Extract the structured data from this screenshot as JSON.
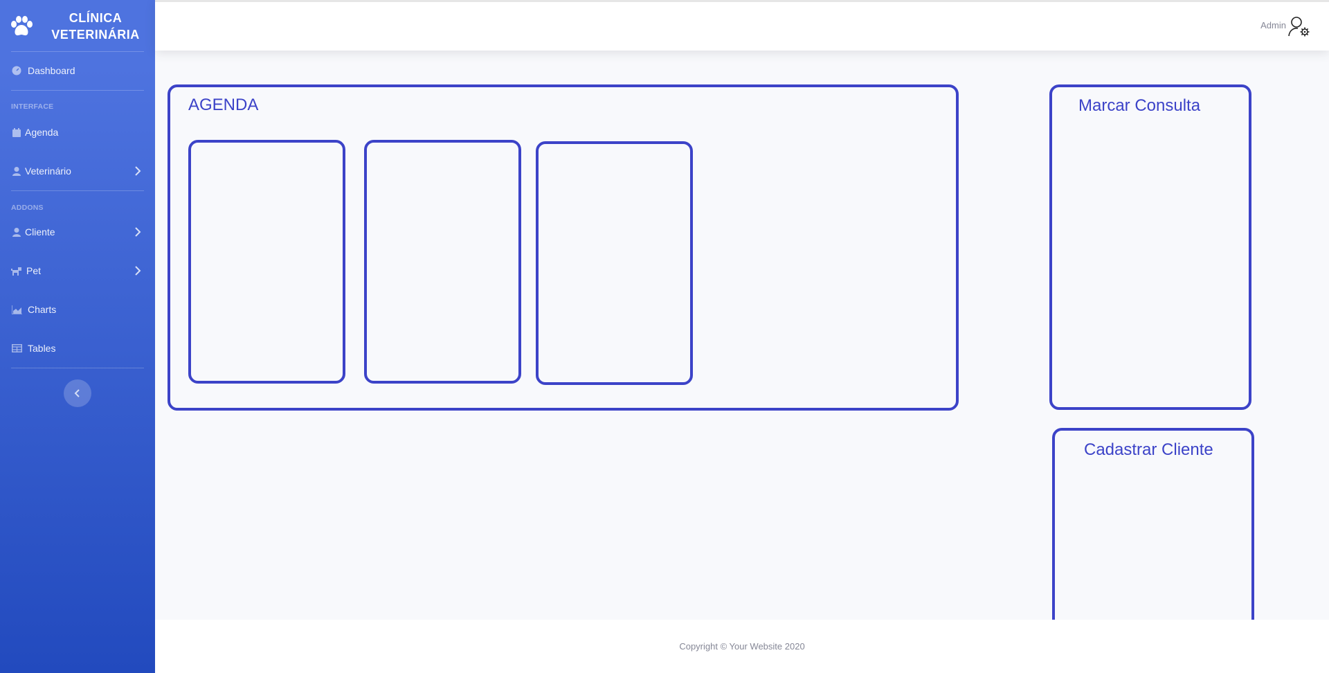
{
  "brand": {
    "line1": "CLÍNICA",
    "line2": "VETERINÁRIA",
    "icon": "paw-icon"
  },
  "sidebar": {
    "dashboard": {
      "label": "Dashboard",
      "icon": "tachometer-icon"
    },
    "heading_interface": "INTERFACE",
    "agenda": {
      "label": "Agenda",
      "icon": "calendar-icon"
    },
    "veterinario": {
      "label": "Veterinário",
      "icon": "user-icon"
    },
    "heading_addons": "ADDONS",
    "cliente": {
      "label": "Cliente",
      "icon": "user-icon"
    },
    "pet": {
      "label": "Pet",
      "icon": "dog-icon"
    },
    "charts": {
      "label": "Charts",
      "icon": "area-chart-icon"
    },
    "tables": {
      "label": "Tables",
      "icon": "table-icon"
    }
  },
  "topbar": {
    "user_name": "Admin",
    "user_icon": "user-gear-icon"
  },
  "main": {
    "agenda_title": "AGENDA",
    "marcar_title": "Marcar Consulta",
    "cadastrar_title": "Cadastrar Cliente"
  },
  "footer": {
    "copyright": "Copyright © Your Website 2020"
  },
  "colors": {
    "sidebar_top": "#4e73df",
    "sidebar_bottom": "#224abe",
    "panel_border": "#3c43c8",
    "content_bg": "#f8f9fc"
  }
}
